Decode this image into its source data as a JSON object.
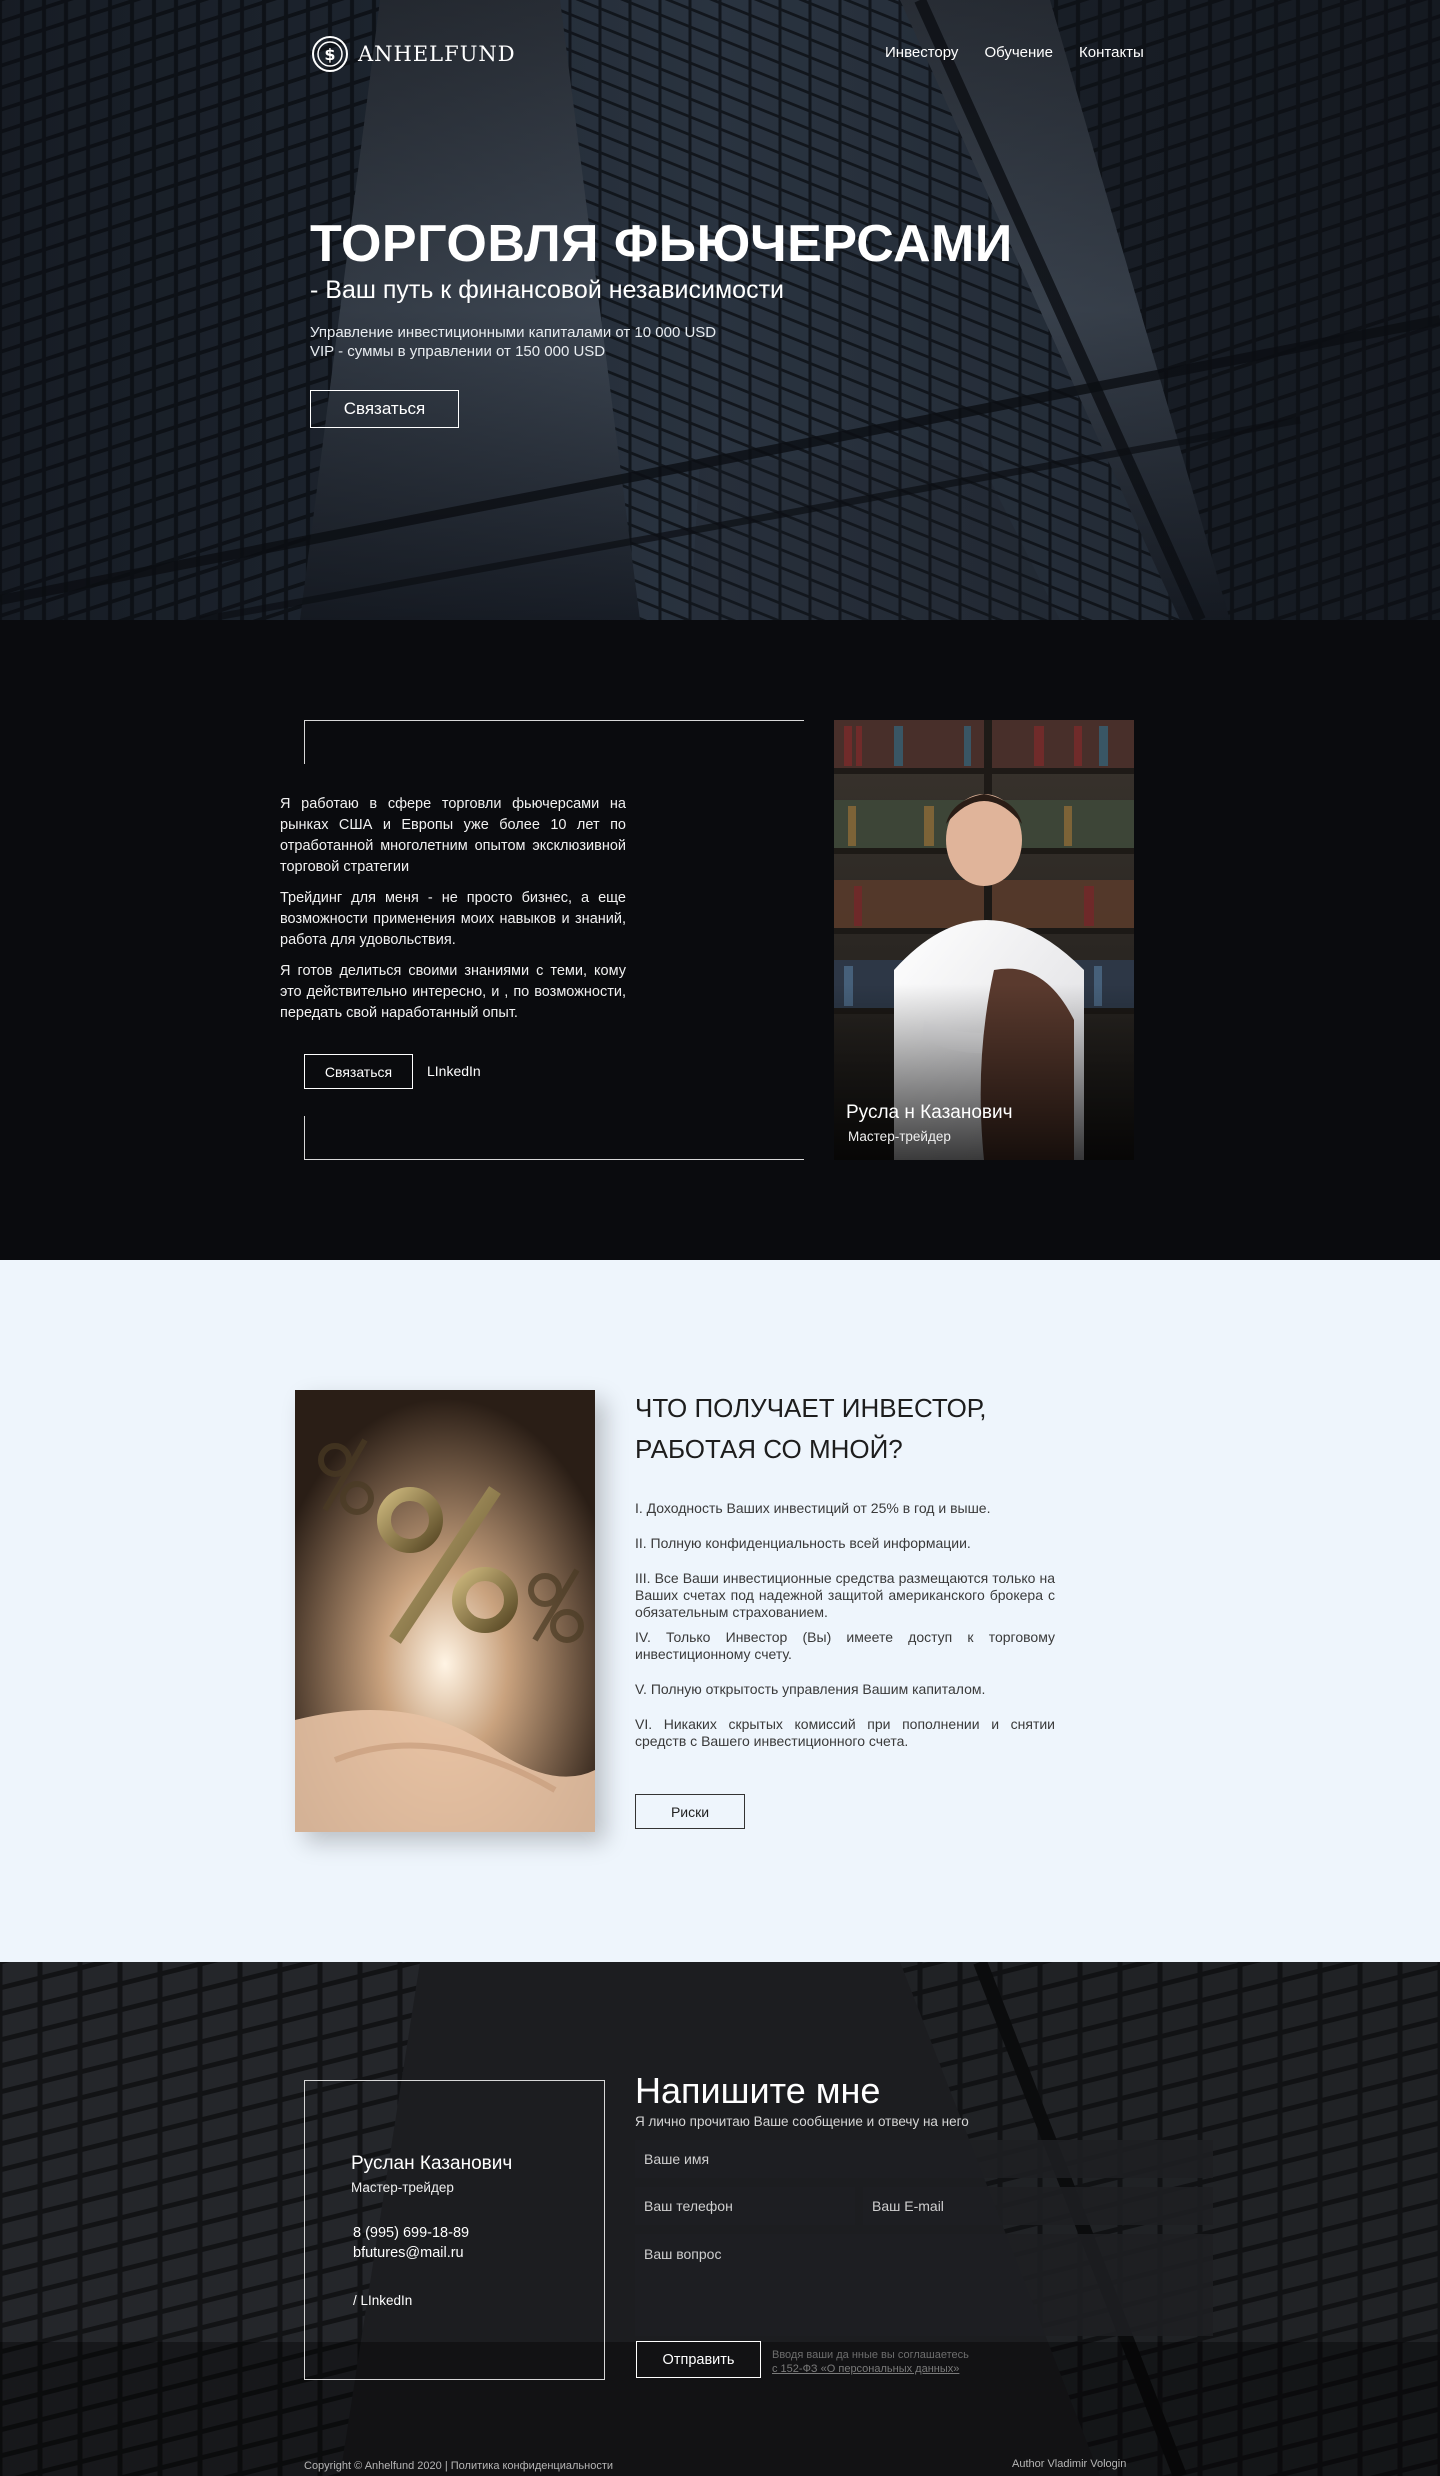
{
  "header": {
    "logo_text": "ANHELFUND",
    "nav": [
      "Инвестору",
      "Обучение",
      "Контакты"
    ]
  },
  "hero": {
    "title": "ТОРГОВЛЯ ФЬЮЧЕРСАМИ",
    "subtitle": "- Ваш путь к финансовой независимости",
    "line1": "Управление инвестиционными капиталами от 10 000 USD",
    "line2": "VIP - суммы в управлении от 150 000 USD",
    "button": "Связаться"
  },
  "about": {
    "paragraphs": [
      "Я работаю в сфере торговли фьючерсами на рынках США и Европы уже более 10 лет по отработанной многолетним опытом эксклюзивной торговой стратегии",
      "Трейдинг для меня - не просто бизнес, а еще возможности применения моих навыков и знаний, работа для удовольствия.",
      "Я готов делиться своими знаниями с теми, кому это действительно интересно, и , по возможности, передать свой наработанный опыт."
    ],
    "button": "Связаться",
    "linkedin": "LInkedIn",
    "photo_name": "Русла н Казанович",
    "photo_role": "Мастер-трейдер"
  },
  "investor": {
    "title_line1": "ЧТО ПОЛУЧАЕТ ИНВЕСТОР,",
    "title_line2": "РАБОТАЯ СО МНОЙ?",
    "items": [
      "I. Доходность Ваших инвестиций от 25% в год и выше.",
      "II. Полную конфиденциальность всей информации.",
      "III. Все Ваши инвестиционные средства размещаются только на Ваших счетах под надежной защитой американского брокера с обязательным страхованием.",
      "IV. Только Инвестор (Вы) имеете доступ к торговому инвестиционному счету.",
      "V. Полную открытость управления Вашим капиталом.",
      "VI. Никаких скрытых комиссий при пополнении и снятии средств с Вашего инвестиционного счета."
    ],
    "risk_button": "Риски"
  },
  "contact": {
    "card_name": "Руслан Казанович",
    "card_role": "Мастер-трейдер",
    "phone": "8 (995) 699-18-89",
    "email": "bfutures@mail.ru",
    "linkedin": "/ LInkedIn",
    "form_title": "Напишите мне",
    "form_subtitle": "Я лично прочитаю Ваше сообщение и отвечу на него",
    "placeholder_name": "Ваше имя",
    "placeholder_phone": "Ваш телефон",
    "placeholder_email": "Ваш E-mail",
    "placeholder_question": "Ваш вопрос",
    "send_button": "Отправить",
    "consent_line1": "Вводя ваши да нные вы соглашаетесь",
    "consent_link": "с 152-ФЗ «О персональных данных»"
  },
  "footer": {
    "copyright": "Copyright © Anhelfund 2020",
    "privacy": "| Политика конфиденциальности",
    "author": "Author Vladimir Vologin"
  },
  "colors": {
    "dark_bg": "#0a0b0e",
    "light_section_bg": "#eef5fc",
    "accent_border": "#d8d8d8"
  }
}
